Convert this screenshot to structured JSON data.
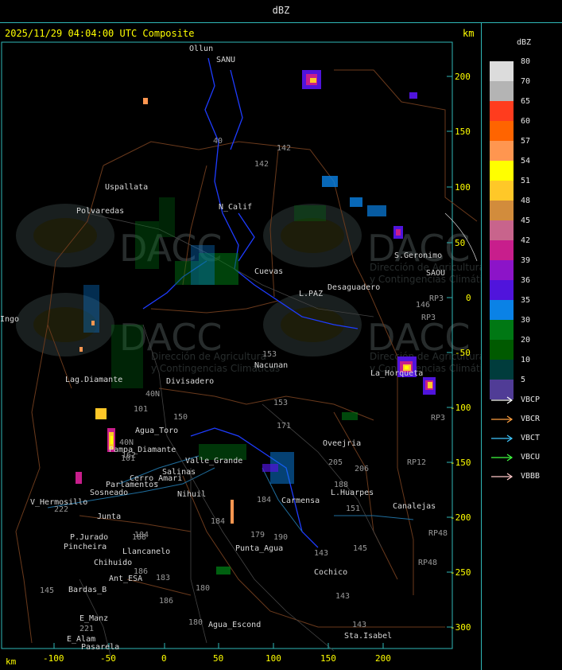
{
  "header": {
    "title": "dBZ"
  },
  "map": {
    "timestamp": "2025/11/29 04:04:00 UTC Composite",
    "km_label_top": "km",
    "km_label_bottom": "km",
    "y_axis_ticks": [
      "200",
      "150",
      "100",
      "50",
      "0",
      "-50",
      "-100",
      "-150",
      "-200",
      "-250",
      "-300"
    ],
    "x_axis_ticks": [
      "-100",
      "-50",
      "0",
      "50",
      "100",
      "150",
      "200"
    ],
    "place_labels": [
      "Ollun",
      "SANU",
      "Uspallata",
      "Polvaredas",
      "N_Calif",
      "S.Geronimo",
      "SAOU",
      "Desaguadero",
      "Cuevas",
      "L.PAZ",
      "Nacunan",
      "La_Horqueta",
      "Divisadero",
      "Lag.Diamante",
      "Agua_Toro",
      "Pampa_Diamante",
      "Valle_Grande",
      "Salinas",
      "Parlamentos",
      "Sosneado",
      "V_Hermosillo",
      "Junta",
      "P.Jurado",
      "Pincheira",
      "Llancanelo",
      "Chihuido",
      "Ant_ESA",
      "Bardas_B",
      "E_Manz",
      "E_Alam",
      "Pasarela",
      "Agua_Escond",
      "Punta_Agua",
      "Carmensa",
      "Oveejria",
      "L.Huarpes",
      "Canalejas",
      "Cochico",
      "Sta.Isabel",
      "Nihuil",
      "Ingo",
      "Cerro_Amari"
    ],
    "route_numbers": [
      "40",
      "142",
      "142",
      "146",
      "153",
      "153",
      "150",
      "171",
      "205",
      "206",
      "188",
      "151",
      "184",
      "190",
      "179",
      "143",
      "143",
      "143",
      "184",
      "183",
      "186",
      "180",
      "145",
      "221",
      "222",
      "40N",
      "40N",
      "RP3",
      "RP3",
      "RP3",
      "RP12",
      "RP48",
      "RP48",
      "145",
      "162",
      "101",
      "101",
      "186",
      "184",
      "180",
      "188"
    ],
    "watermark": {
      "name": "DACC",
      "subtitle_line1": "Dirección de Agricultura",
      "subtitle_line2": "y Contingencias Climáticas"
    }
  },
  "legend": {
    "unit": "dBZ",
    "scale": [
      {
        "value": "80",
        "color": "#dcdcdc"
      },
      {
        "value": "70",
        "color": "#b4b4b4"
      },
      {
        "value": "65",
        "color": "#ff3c1e"
      },
      {
        "value": "60",
        "color": "#ff6400"
      },
      {
        "value": "57",
        "color": "#ff9650"
      },
      {
        "value": "54",
        "color": "#ffff00"
      },
      {
        "value": "51",
        "color": "#ffc828"
      },
      {
        "value": "48",
        "color": "#d28c3c"
      },
      {
        "value": "45",
        "color": "#c8648c"
      },
      {
        "value": "42",
        "color": "#c81e8c"
      },
      {
        "value": "39",
        "color": "#8c14c8"
      },
      {
        "value": "36",
        "color": "#5014dc"
      },
      {
        "value": "35",
        "color": "#0a82e6"
      },
      {
        "value": "30",
        "color": "#007814"
      },
      {
        "value": "20",
        "color": "#005a00"
      },
      {
        "value": "10",
        "color": "#003c3c"
      },
      {
        "value": "5",
        "color": "#503c96"
      }
    ],
    "radars": [
      {
        "name": "VBCP",
        "color": "#ffffff"
      },
      {
        "name": "VBCR",
        "color": "#ffa040"
      },
      {
        "name": "VBCT",
        "color": "#40c8ff"
      },
      {
        "name": "VBCU",
        "color": "#40ff40"
      },
      {
        "name": "VBBB",
        "color": "#ffc8c8"
      }
    ]
  }
}
